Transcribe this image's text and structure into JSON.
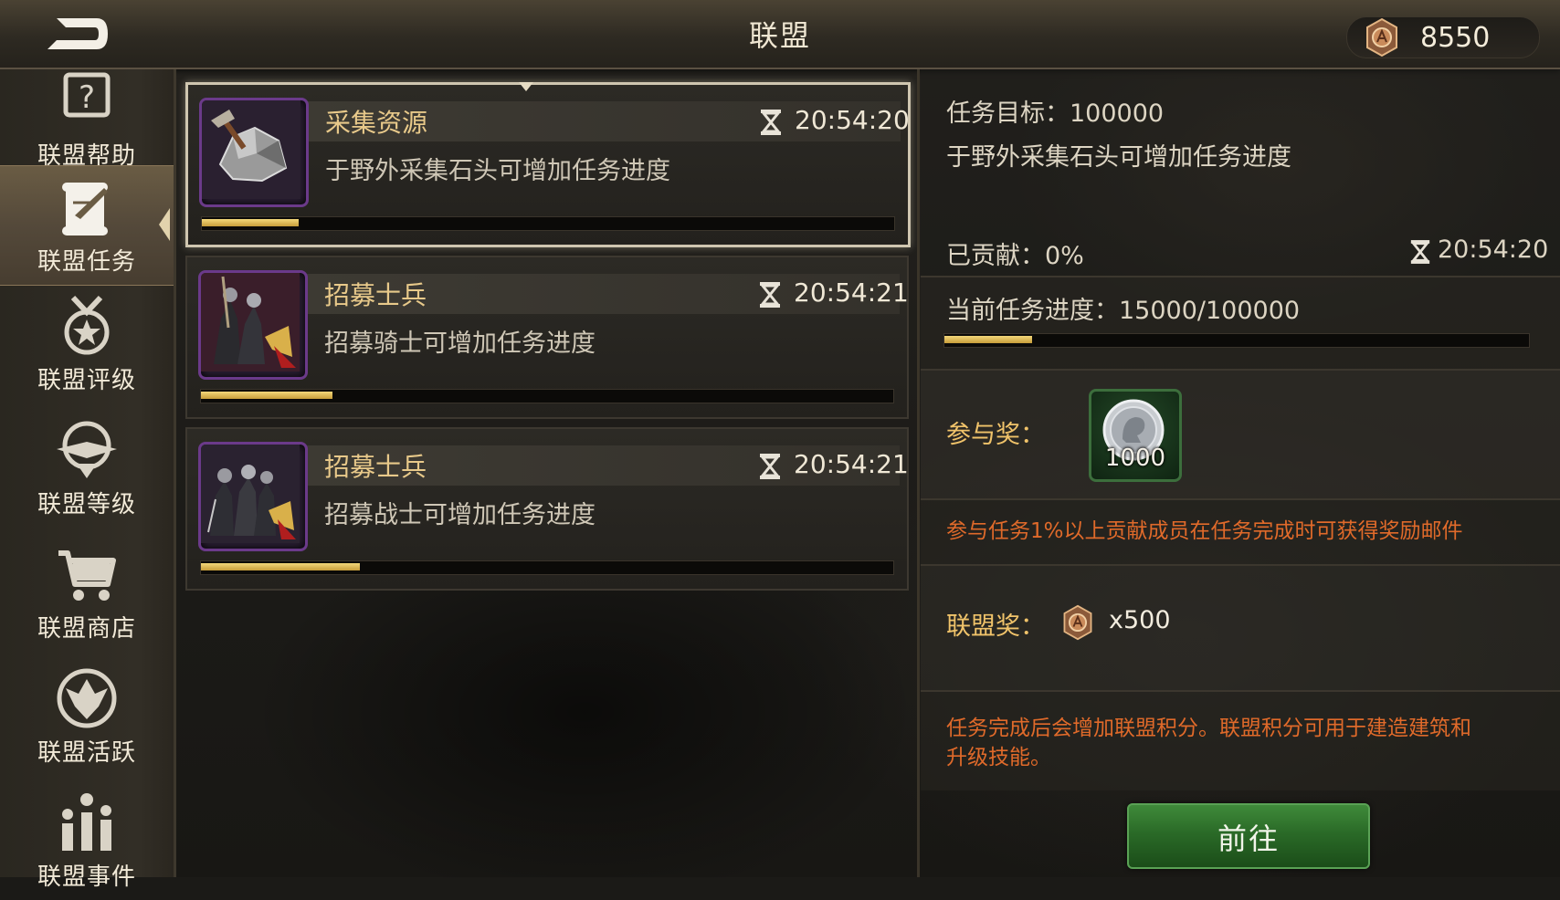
{
  "header": {
    "title": "联盟",
    "currency_value": "8550"
  },
  "sidebar": {
    "items": [
      {
        "label": "联盟帮助",
        "icon": "help-book-icon"
      },
      {
        "label": "联盟任务",
        "icon": "scroll-quill-icon",
        "active": true
      },
      {
        "label": "联盟评级",
        "icon": "star-medal-icon"
      },
      {
        "label": "联盟等级",
        "icon": "winged-emblem-icon"
      },
      {
        "label": "联盟商店",
        "icon": "shopping-cart-icon"
      },
      {
        "label": "联盟活跃",
        "icon": "eagle-crest-icon"
      },
      {
        "label": "联盟事件",
        "icon": "event-chart-icon"
      }
    ]
  },
  "tasks": [
    {
      "name": "采集资源",
      "timer": "20:54:20",
      "description": "于野外采集石头可增加任务进度",
      "progress": 0.14,
      "thumb": "stone-ore-icon",
      "selected": true
    },
    {
      "name": "招募士兵",
      "timer": "20:54:21",
      "description": "招募骑士可增加任务进度",
      "progress": 0.19,
      "thumb": "knights-horn-icon"
    },
    {
      "name": "招募士兵",
      "timer": "20:54:21",
      "description": "招募战士可增加任务进度",
      "progress": 0.23,
      "thumb": "warriors-horn-icon"
    }
  ],
  "detail": {
    "goal": "任务目标：100000",
    "description": "于野外采集石头可增加任务进度",
    "contributed": "已贡献：0%",
    "timer": "20:54:20",
    "current_progress": "当前任务进度：15000/100000",
    "progress": 0.15,
    "participation_label": "参与奖：",
    "participation_qty": "1000",
    "participation_note": "参与任务1%以上贡献成员在任务完成时可获得奖励邮件",
    "alliance_reward_label": "联盟奖：",
    "alliance_reward_qty": "x500",
    "footer_note_line1": "任务完成后会增加联盟积分。联盟积分可用于建造建筑和",
    "footer_note_line2": "升级技能。",
    "go_button": "前往"
  }
}
